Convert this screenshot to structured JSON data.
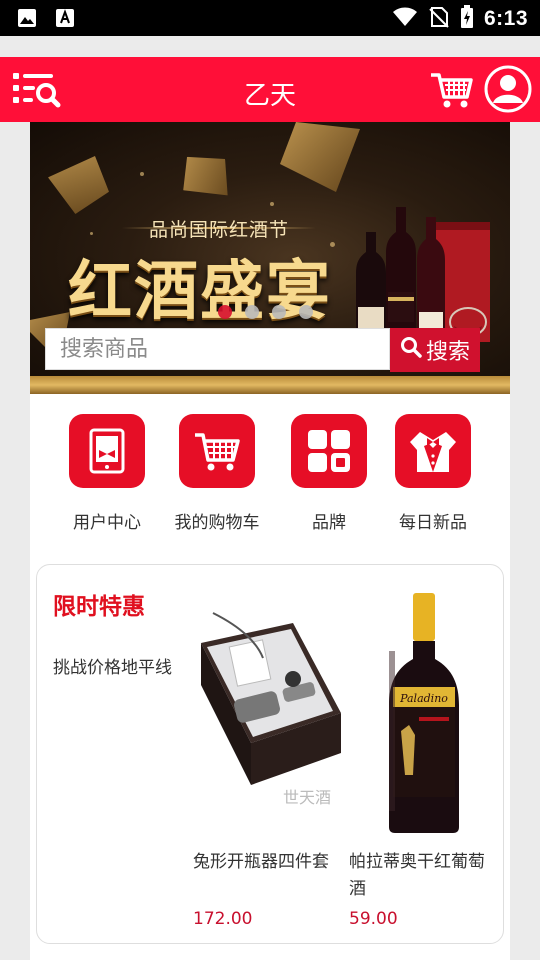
{
  "status_bar": {
    "time": "6:13",
    "left_icons": [
      "image-icon",
      "font-icon"
    ],
    "right_icons": [
      "wifi-icon",
      "no-sim-icon",
      "battery-charging-icon"
    ]
  },
  "app_bar": {
    "title": "乙天",
    "background": "#ff0f38",
    "icons": [
      "menu-search-icon",
      "shopping-cart-icon",
      "user-avatar-icon"
    ]
  },
  "banner": {
    "subtitle": "品尚国际红酒节",
    "headline": "红酒盛宴",
    "slide_count": 4,
    "active_slide": 0
  },
  "search": {
    "placeholder": "搜索商品",
    "button_label": "搜索"
  },
  "quick_nav": [
    {
      "label": "用户中心",
      "icon": "user-center-icon"
    },
    {
      "label": "我的购物车",
      "icon": "shopping-cart-icon"
    },
    {
      "label": "品牌",
      "icon": "brand-grid-icon"
    },
    {
      "label": "每日新品",
      "icon": "tuxedo-icon"
    }
  ],
  "promo": {
    "title": "限时特惠",
    "slogan": "挑战价格地平线",
    "products": [
      {
        "name": "兔形开瓶器四件套",
        "price": "172.00",
        "image_watermark": "世天酒"
      },
      {
        "name": "帕拉蒂奥干红葡萄酒",
        "price": "59.00",
        "bottle_label": "Paladino"
      }
    ]
  },
  "colors": {
    "accent": "#e60e26",
    "price": "#c8102e",
    "title_red": "#e0101f"
  }
}
